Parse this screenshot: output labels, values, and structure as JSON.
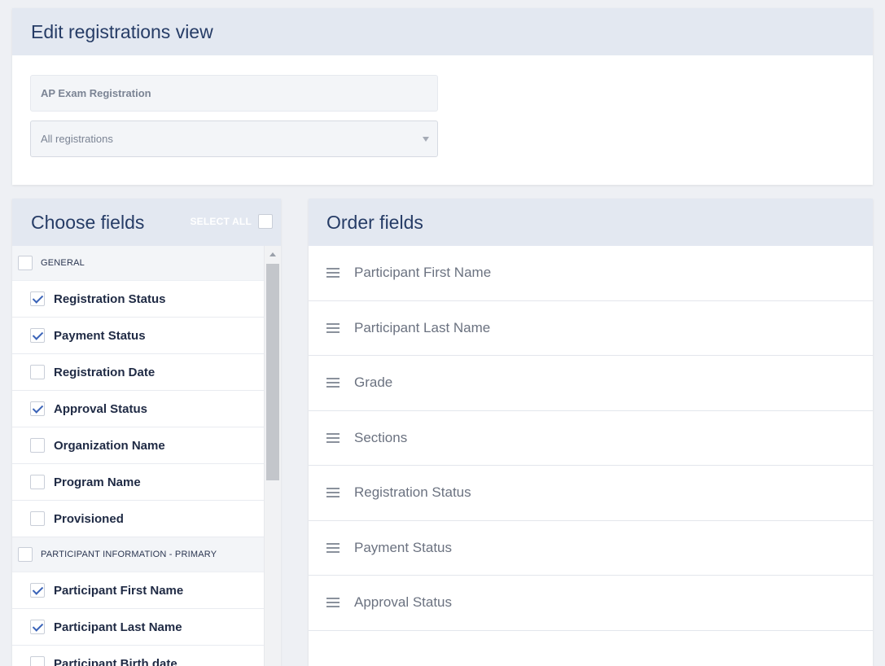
{
  "edit_view": {
    "title": "Edit registrations view",
    "name_value": "AP Exam Registration",
    "filter_selected": "All registrations"
  },
  "choose_fields": {
    "title": "Choose fields",
    "select_all_label": "SELECT ALL",
    "groups": [
      {
        "label": "GENERAL",
        "fields": [
          {
            "label": "Registration Status",
            "checked": true
          },
          {
            "label": "Payment Status",
            "checked": true
          },
          {
            "label": "Registration Date",
            "checked": false
          },
          {
            "label": "Approval Status",
            "checked": true
          },
          {
            "label": "Organization Name",
            "checked": false
          },
          {
            "label": "Program Name",
            "checked": false
          },
          {
            "label": "Provisioned",
            "checked": false
          }
        ]
      },
      {
        "label": "PARTICIPANT INFORMATION - PRIMARY",
        "fields": [
          {
            "label": "Participant First Name",
            "checked": true
          },
          {
            "label": "Participant Last Name",
            "checked": true
          },
          {
            "label": "Participant Birth date",
            "checked": false
          }
        ]
      }
    ]
  },
  "order_fields": {
    "title": "Order fields",
    "items": [
      "Participant First Name",
      "Participant Last Name",
      "Grade",
      "Sections",
      "Registration Status",
      "Payment Status",
      "Approval Status"
    ]
  }
}
